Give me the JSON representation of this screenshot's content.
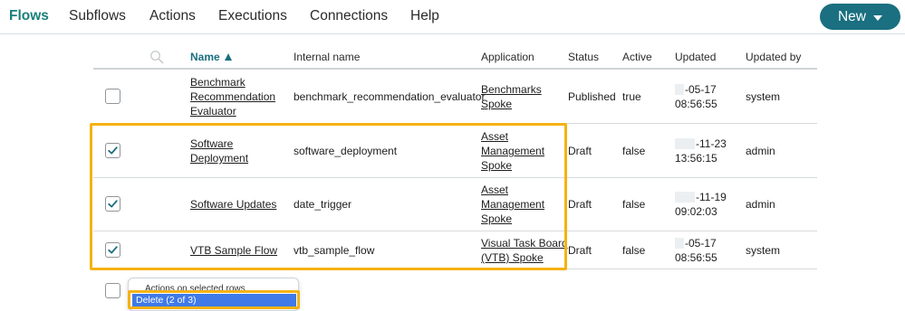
{
  "nav": {
    "items": [
      "Flows",
      "Subflows",
      "Actions",
      "Executions",
      "Connections",
      "Help"
    ],
    "new_label": "New"
  },
  "table": {
    "headers": {
      "name": "Name",
      "internal": "Internal name",
      "application": "Application",
      "status": "Status",
      "active": "Active",
      "updated": "Updated",
      "updated_by": "Updated by"
    },
    "rows": [
      {
        "checked": false,
        "name": [
          "Benchmark",
          "Recommendation",
          "Evaluator"
        ],
        "internal": "benchmark_recommendation_evaluator",
        "application": [
          "Benchmarks",
          "Spoke"
        ],
        "status": "Published",
        "active": "true",
        "updated_date": "-05-17",
        "updated_time": "08:56:55",
        "updated_by": "system"
      },
      {
        "checked": true,
        "name": [
          "Software",
          "Deployment"
        ],
        "internal": "software_deployment",
        "application": [
          "Asset",
          "Management",
          "Spoke"
        ],
        "status": "Draft",
        "active": "false",
        "updated_date": "-11-23",
        "updated_time": "13:56:15",
        "updated_by": "admin"
      },
      {
        "checked": true,
        "name": [
          "Software Updates"
        ],
        "internal": "date_trigger",
        "application": [
          "Asset",
          "Management",
          "Spoke"
        ],
        "status": "Draft",
        "active": "false",
        "updated_date": "-11-19",
        "updated_time": "09:02:03",
        "updated_by": "admin"
      },
      {
        "checked": true,
        "name": [
          "VTB Sample Flow"
        ],
        "internal": "vtb_sample_flow",
        "application": [
          "Visual Task Board",
          "(VTB) Spoke"
        ],
        "status": "Draft",
        "active": "false",
        "updated_date": "-05-17",
        "updated_time": "08:56:55",
        "updated_by": "system"
      }
    ]
  },
  "bulk_actions": {
    "header": "Actions on selected rows",
    "item": "Delete (2 of 3)"
  },
  "colors": {
    "accent": "#1a6f80",
    "active_tab": "#19807a",
    "highlight": "#f5b214",
    "menu_selected": "#3f7ae8"
  }
}
